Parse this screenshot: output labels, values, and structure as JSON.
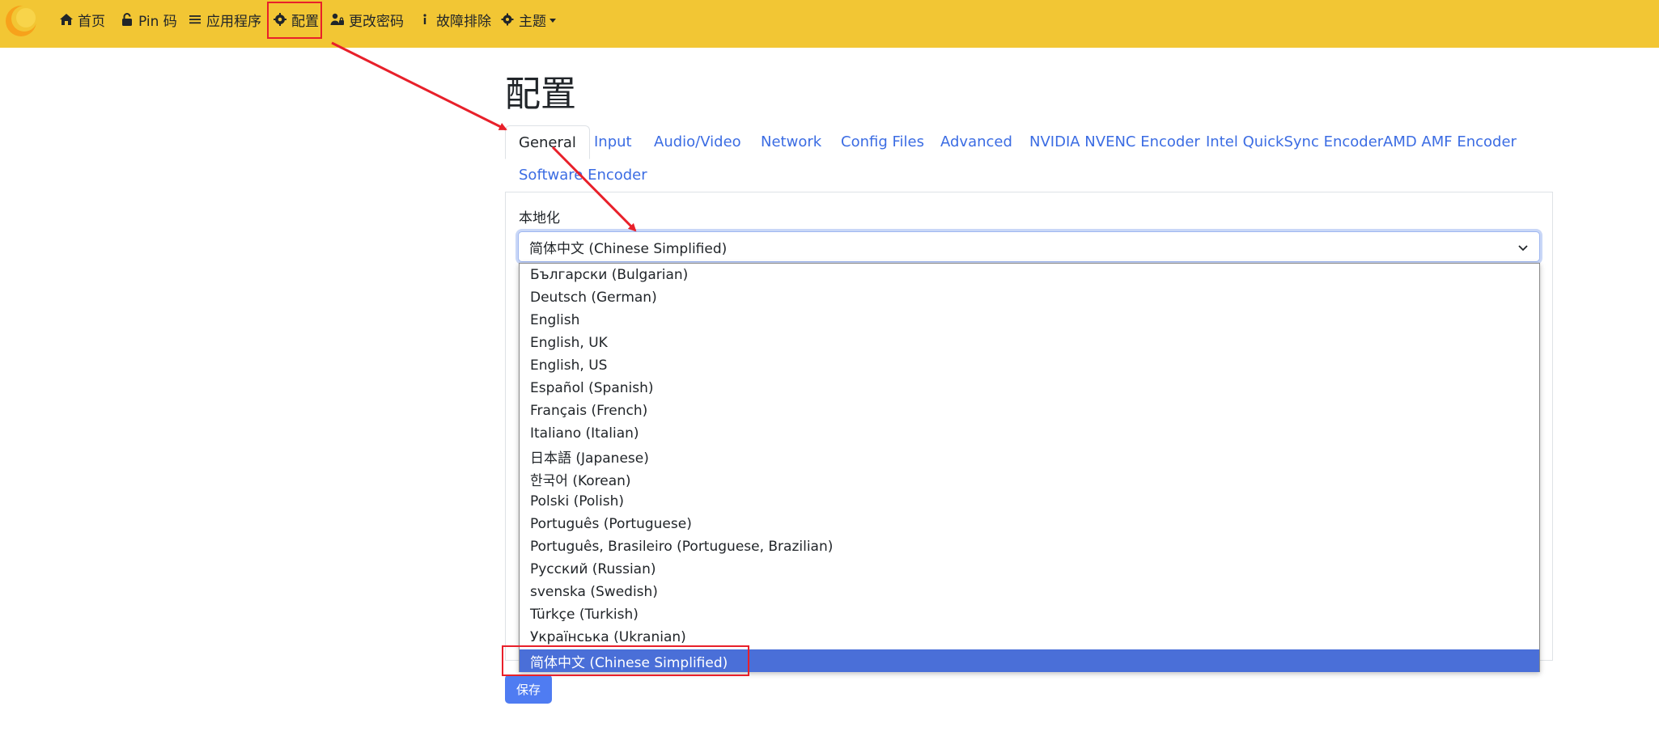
{
  "navbar": {
    "accent_color": "#f2c634",
    "items": [
      {
        "icon": "home-icon",
        "label": "首页"
      },
      {
        "icon": "lock-icon",
        "label": "Pin 码"
      },
      {
        "icon": "list-icon",
        "label": "应用程序"
      },
      {
        "icon": "gear-icon",
        "label": "配置"
      },
      {
        "icon": "user-lock-icon",
        "label": "更改密码"
      },
      {
        "icon": "info-icon",
        "label": "故障排除"
      },
      {
        "icon": "theme-gear-icon",
        "label": "主题"
      }
    ]
  },
  "page": {
    "title": "配置"
  },
  "tabs": [
    {
      "label": "General",
      "active": true
    },
    {
      "label": "Input"
    },
    {
      "label": "Audio/Video"
    },
    {
      "label": "Network"
    },
    {
      "label": "Config Files"
    },
    {
      "label": "Advanced"
    },
    {
      "label": "NVIDIA NVENC Encoder"
    },
    {
      "label": "Intel QuickSync Encoder"
    },
    {
      "label": "AMD AMF Encoder"
    },
    {
      "label": "Software Encoder"
    }
  ],
  "localization": {
    "label": "本地化",
    "selected": "简体中文 (Chinese Simplified)",
    "options": [
      "Български (Bulgarian)",
      "Deutsch (German)",
      "English",
      "English, UK",
      "English, US",
      "Español (Spanish)",
      "Français (French)",
      "Italiano (Italian)",
      "日本語 (Japanese)",
      "한국어 (Korean)",
      "Polski (Polish)",
      "Português (Portuguese)",
      "Português, Brasileiro (Portuguese, Brazilian)",
      "Русский (Russian)",
      "svenska (Swedish)",
      "Türkçe (Turkish)",
      "Українська (Ukranian)",
      "简体中文 (Chinese Simplified)"
    ]
  },
  "save_label": "保存",
  "annotation_color": "#e8202a"
}
